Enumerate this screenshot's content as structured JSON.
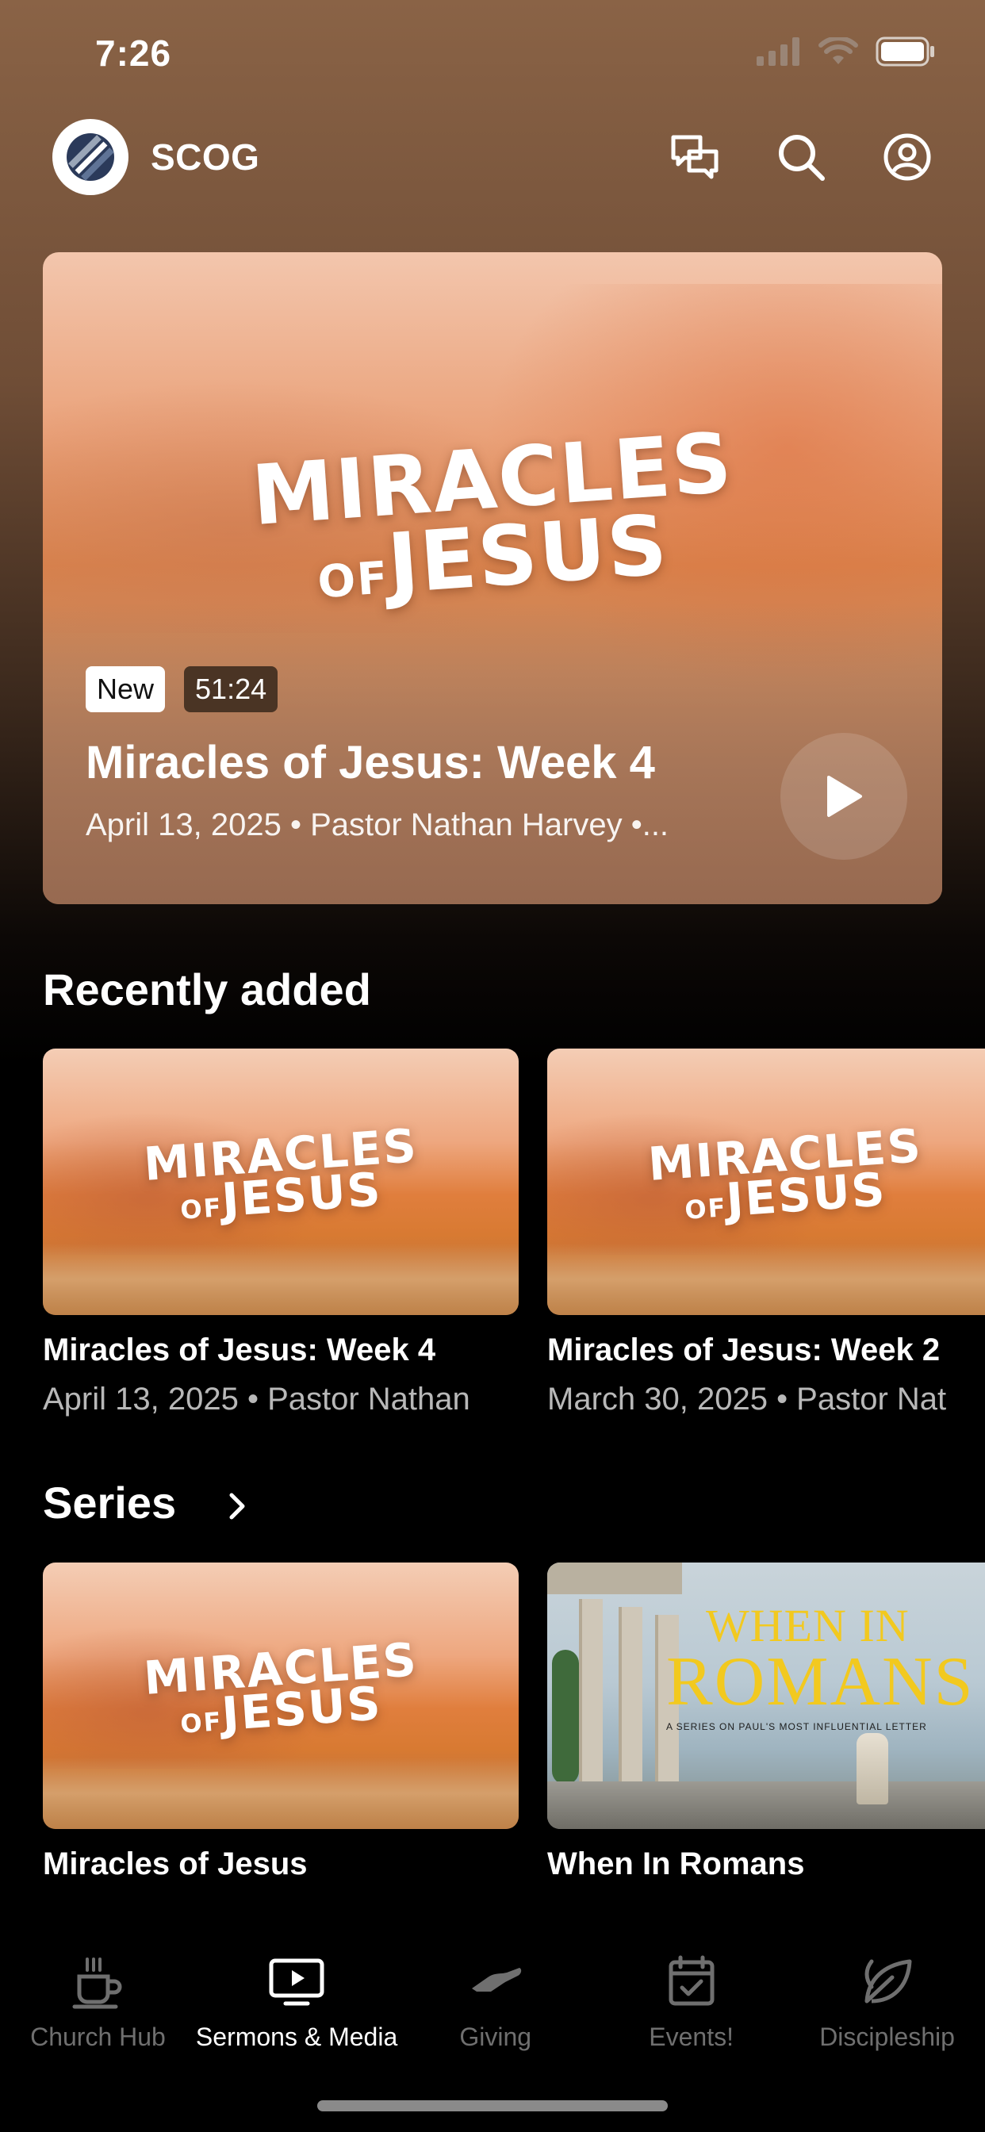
{
  "status_bar": {
    "time": "7:26"
  },
  "header": {
    "app_name": "SCOG"
  },
  "featured": {
    "badge_new": "New",
    "duration": "51:24",
    "title": "Miracles of Jesus: Week 4",
    "meta": "April 13, 2025 • Pastor Nathan Harvey •...",
    "art_line1": "MIRACLES",
    "art_line2_small": "OF",
    "art_line2": "JESUS"
  },
  "recently_added": {
    "heading": "Recently added",
    "items": [
      {
        "title": "Miracles of Jesus: Week 4",
        "meta": "April 13, 2025 • Pastor Nathan",
        "art_line1": "MIRACLES",
        "art_small": "OF",
        "art_line2": "JESUS"
      },
      {
        "title": "Miracles of Jesus: Week 2",
        "meta": "March 30, 2025 • Pastor Nat",
        "art_line1": "MIRACLES",
        "art_small": "OF",
        "art_line2": "JESUS"
      }
    ]
  },
  "series": {
    "heading": "Series",
    "items": [
      {
        "title": "Miracles of Jesus",
        "art_line1": "MIRACLES",
        "art_small": "OF",
        "art_line2": "JESUS"
      },
      {
        "title": "When In Romans",
        "art_line1": "WHEN IN",
        "art_line2": "ROMANS",
        "art_sub": "A SERIES ON PAUL'S MOST INFLUENTIAL LETTER"
      }
    ]
  },
  "tabs": [
    {
      "label": "Church Hub",
      "icon": "coffee-cup-icon",
      "active": false
    },
    {
      "label": "Sermons & Media",
      "icon": "tv-play-icon",
      "active": true
    },
    {
      "label": "Giving",
      "icon": "giving-hand-icon",
      "active": false
    },
    {
      "label": "Events!",
      "icon": "calendar-check-icon",
      "active": false
    },
    {
      "label": "Discipleship",
      "icon": "leaf-icon",
      "active": false
    }
  ],
  "colors": {
    "accent": "#ffffff",
    "inactive_tab": "#6f6f6f",
    "header_brown": "#8a6346"
  }
}
